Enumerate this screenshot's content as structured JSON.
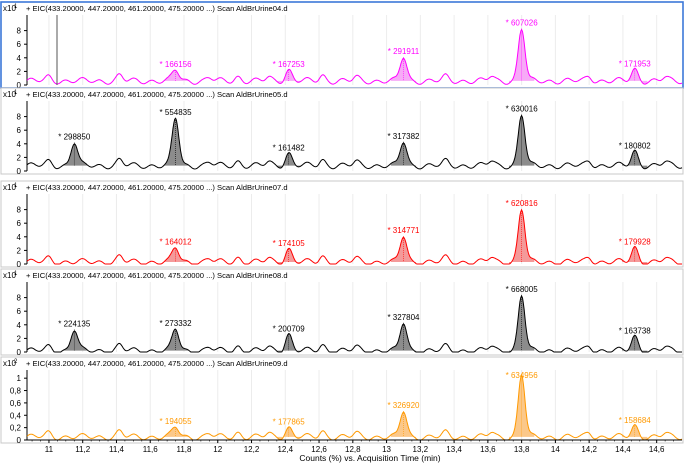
{
  "chart_data": {
    "type": "line",
    "xlabel": "Counts (%) vs. Acquisition Time (min)",
    "x_ticks": [
      "11",
      "11,2",
      "11,4",
      "11,6",
      "11,8",
      "12",
      "12,2",
      "12,4",
      "12,6",
      "12,8",
      "13",
      "13,2",
      "13,4",
      "13,6",
      "13,8",
      "14",
      "14,2",
      "14,4",
      "14,6"
    ],
    "xlim": [
      10.87,
      14.75
    ],
    "panels": [
      {
        "title": "+ EIC(433.20000, 447.20000, 461.20000, 475.20000 ...) Scan AldBrUrine04.d",
        "multiplier": "x10",
        "multiplier_exp": "1",
        "color": "#ff00ff",
        "fill": "#f7aaf7",
        "selected": true,
        "ylim": [
          0,
          10
        ],
        "y_ticks": [
          "0",
          "2",
          "4",
          "6",
          "8"
        ],
        "baseline": 0.6,
        "peaks": [
          {
            "x": 11.75,
            "height": 2.2,
            "label": "* 166156"
          },
          {
            "x": 12.42,
            "height": 2.2,
            "label": "* 167253"
          },
          {
            "x": 13.1,
            "height": 4.1,
            "label": "* 291911"
          },
          {
            "x": 13.8,
            "height": 8.3,
            "label": "* 607026"
          },
          {
            "x": 14.47,
            "height": 2.3,
            "label": "* 171953"
          }
        ]
      },
      {
        "title": "+ EIC(433.20000, 447.20000, 461.20000, 475.20000 ...) Scan AldBrUrine05.d",
        "multiplier": "x10",
        "multiplier_exp": "1",
        "color": "#000000",
        "fill": "#8c8c8c",
        "ylim": [
          0,
          10
        ],
        "y_ticks": [
          "0",
          "2",
          "4",
          "6",
          "8"
        ],
        "baseline": 0.8,
        "peaks": [
          {
            "x": 11.15,
            "height": 4.2,
            "label": "* 298850"
          },
          {
            "x": 11.75,
            "height": 7.8,
            "label": "* 554835"
          },
          {
            "x": 12.42,
            "height": 2.6,
            "label": "* 161482"
          },
          {
            "x": 13.1,
            "height": 4.3,
            "label": "* 317382"
          },
          {
            "x": 13.8,
            "height": 8.3,
            "label": "* 630016"
          },
          {
            "x": 14.47,
            "height": 2.9,
            "label": "* 180802"
          }
        ]
      },
      {
        "title": "+ EIC(433.20000, 447.20000, 461.20000, 475.20000 ...) Scan AldBrUrine07.d",
        "multiplier": "x10",
        "multiplier_exp": "1",
        "color": "#ff0000",
        "fill": "#f49a9a",
        "ylim": [
          0,
          10
        ],
        "y_ticks": [
          "0",
          "2",
          "4",
          "6",
          "8"
        ],
        "baseline": 0.3,
        "peaks": [
          {
            "x": 11.75,
            "height": 2.4,
            "label": "* 164012"
          },
          {
            "x": 12.42,
            "height": 2.2,
            "label": "* 174105"
          },
          {
            "x": 13.1,
            "height": 4.1,
            "label": "* 314771"
          },
          {
            "x": 13.8,
            "height": 8.1,
            "label": "* 620816"
          },
          {
            "x": 14.47,
            "height": 2.4,
            "label": "* 179928"
          }
        ]
      },
      {
        "title": "+ EIC(433.20000, 447.20000, 461.20000, 475.20000 ...) Scan AldBrUrine08.d",
        "multiplier": "x10",
        "multiplier_exp": "1",
        "color": "#000000",
        "fill": "#8c8c8c",
        "ylim": [
          0,
          10
        ],
        "y_ticks": [
          "0",
          "2",
          "4",
          "6",
          "8"
        ],
        "baseline": 0.2,
        "peaks": [
          {
            "x": 11.15,
            "height": 3.3,
            "label": "* 224135"
          },
          {
            "x": 11.75,
            "height": 3.4,
            "label": "* 273332"
          },
          {
            "x": 12.42,
            "height": 2.6,
            "label": "* 200709"
          },
          {
            "x": 13.1,
            "height": 4.3,
            "label": "* 327804"
          },
          {
            "x": 13.8,
            "height": 8.4,
            "label": "* 668005"
          },
          {
            "x": 14.47,
            "height": 2.3,
            "label": "* 163738"
          }
        ]
      },
      {
        "title": "+ EIC(433.20000, 447.20000, 461.20000, 475.20000 ...) Scan AldBrUrine09.d",
        "multiplier": "x10",
        "multiplier_exp": "2",
        "color": "#ff9900",
        "fill": "#fbc88a",
        "ylim": [
          0,
          1.1
        ],
        "y_ticks": [
          "0",
          "0,2",
          "0,4",
          "0,6",
          "0,8",
          "1"
        ],
        "baseline": 0.05,
        "peaks": [
          {
            "x": 11.75,
            "height": 0.21,
            "label": "* 194055"
          },
          {
            "x": 12.42,
            "height": 0.2,
            "label": "* 177865"
          },
          {
            "x": 13.1,
            "height": 0.47,
            "label": "* 326920"
          },
          {
            "x": 13.8,
            "height": 1.06,
            "label": "* 634956"
          },
          {
            "x": 14.47,
            "height": 0.23,
            "label": "* 158684"
          }
        ]
      }
    ]
  }
}
